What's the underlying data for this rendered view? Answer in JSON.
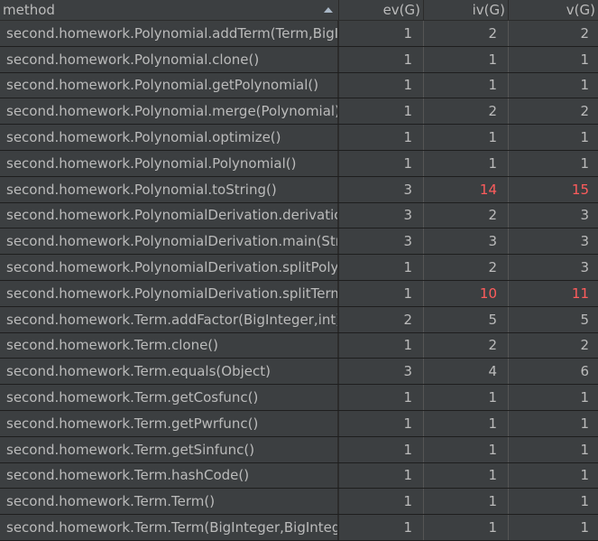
{
  "columns": {
    "method": "method",
    "ev": "ev(G)",
    "iv": "iv(G)",
    "v": "v(G)"
  },
  "colors": {
    "normal": "#bbbbbb",
    "highlight": "#ff5c5c",
    "row_bg": "#3c3f41",
    "background": "#2b2b2b"
  },
  "rows": [
    {
      "method": "second.homework.Polynomial.addTerm(Term,BigIr",
      "ev": "1",
      "iv": "2",
      "v": "2"
    },
    {
      "method": "second.homework.Polynomial.clone()",
      "ev": "1",
      "iv": "1",
      "v": "1"
    },
    {
      "method": "second.homework.Polynomial.getPolynomial()",
      "ev": "1",
      "iv": "1",
      "v": "1"
    },
    {
      "method": "second.homework.Polynomial.merge(Polynomial)",
      "ev": "1",
      "iv": "2",
      "v": "2"
    },
    {
      "method": "second.homework.Polynomial.optimize()",
      "ev": "1",
      "iv": "1",
      "v": "1"
    },
    {
      "method": "second.homework.Polynomial.Polynomial()",
      "ev": "1",
      "iv": "1",
      "v": "1"
    },
    {
      "method": "second.homework.Polynomial.toString()",
      "ev": "3",
      "iv": "14",
      "v": "15",
      "iv_hot": true,
      "v_hot": true
    },
    {
      "method": "second.homework.PolynomialDerivation.derivation",
      "ev": "3",
      "iv": "2",
      "v": "3"
    },
    {
      "method": "second.homework.PolynomialDerivation.main(Strin",
      "ev": "3",
      "iv": "3",
      "v": "3"
    },
    {
      "method": "second.homework.PolynomialDerivation.splitPoly(S",
      "ev": "1",
      "iv": "2",
      "v": "3"
    },
    {
      "method": "second.homework.PolynomialDerivation.splitTerm",
      "ev": "1",
      "iv": "10",
      "v": "11",
      "iv_hot": true,
      "v_hot": true
    },
    {
      "method": "second.homework.Term.addFactor(BigInteger,int)",
      "ev": "2",
      "iv": "5",
      "v": "5"
    },
    {
      "method": "second.homework.Term.clone()",
      "ev": "1",
      "iv": "2",
      "v": "2"
    },
    {
      "method": "second.homework.Term.equals(Object)",
      "ev": "3",
      "iv": "4",
      "v": "6"
    },
    {
      "method": "second.homework.Term.getCosfunc()",
      "ev": "1",
      "iv": "1",
      "v": "1"
    },
    {
      "method": "second.homework.Term.getPwrfunc()",
      "ev": "1",
      "iv": "1",
      "v": "1"
    },
    {
      "method": "second.homework.Term.getSinfunc()",
      "ev": "1",
      "iv": "1",
      "v": "1"
    },
    {
      "method": "second.homework.Term.hashCode()",
      "ev": "1",
      "iv": "1",
      "v": "1"
    },
    {
      "method": "second.homework.Term.Term()",
      "ev": "1",
      "iv": "1",
      "v": "1"
    },
    {
      "method": "second.homework.Term.Term(BigInteger,BigIntege",
      "ev": "1",
      "iv": "1",
      "v": "1"
    }
  ]
}
